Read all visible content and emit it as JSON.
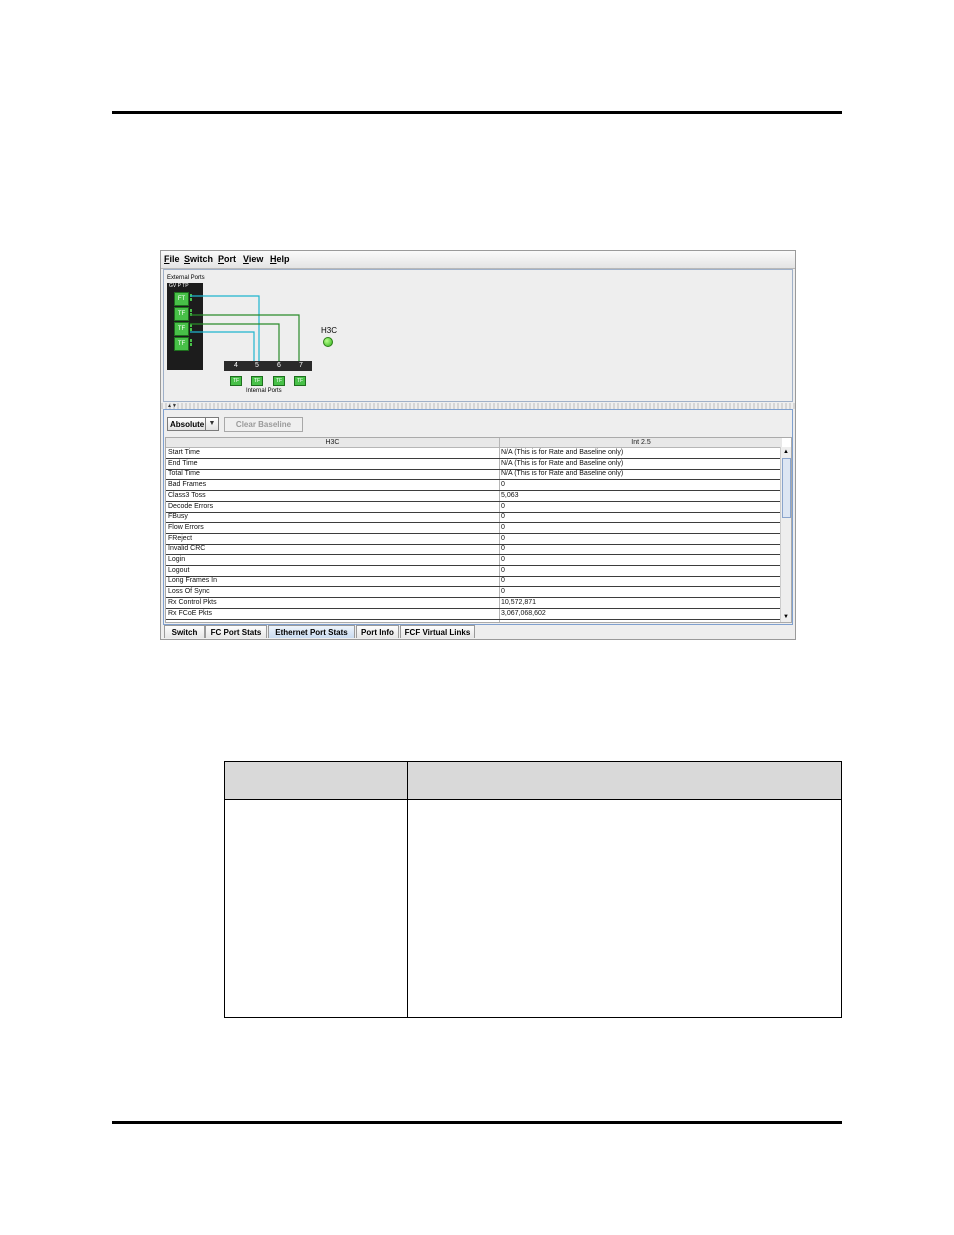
{
  "menu": [
    "File",
    "Switch",
    "Port",
    "View",
    "Help"
  ],
  "topology": {
    "external_title": "External Ports",
    "external_header": "GV  P  TP",
    "external_ports": [
      "FT",
      "TF",
      "TF",
      "TF"
    ],
    "internal_numbers": [
      "4",
      "5",
      "6",
      "7"
    ],
    "internal_port_glyph": "TF",
    "internal_title": "Internal Ports",
    "node_label": "H3C",
    "colors": {
      "wire_cyan": "#1fb5cf",
      "wire_green": "#2a8a2a",
      "led": "#33b41c",
      "port": "#48c048"
    }
  },
  "stats": {
    "mode": "Absolute",
    "clear_baseline": "Clear Baseline",
    "col_left": "H3C",
    "col_right": "Int 2.5",
    "rows": [
      [
        "Start Time",
        "N/A (This is for Rate and Baseline only)"
      ],
      [
        "End Time",
        "N/A (This is for Rate and Baseline only)"
      ],
      [
        "Total Time",
        "N/A (This is for Rate and Baseline only)"
      ],
      [
        "Bad Frames",
        "0"
      ],
      [
        "Class3 Toss",
        "5,063"
      ],
      [
        "Decode Errors",
        "0"
      ],
      [
        "FBusy",
        "0"
      ],
      [
        "Flow Errors",
        "0"
      ],
      [
        "FReject",
        "0"
      ],
      [
        "Invalid CRC",
        "0"
      ],
      [
        "Login",
        "0"
      ],
      [
        "Logout",
        "0"
      ],
      [
        "Long Frames In",
        "0"
      ],
      [
        "Loss Of Sync",
        "0"
      ],
      [
        "Rx Control Pkts",
        "10,572,871"
      ],
      [
        "Rx FCoE Pkts",
        "3,067,068,602"
      ]
    ]
  },
  "tabs": [
    "Switch",
    "FC Port Stats",
    "Ethernet Port Stats",
    "Port Info",
    "FCF Virtual Links"
  ],
  "active_tab": "Ethernet Port Stats"
}
